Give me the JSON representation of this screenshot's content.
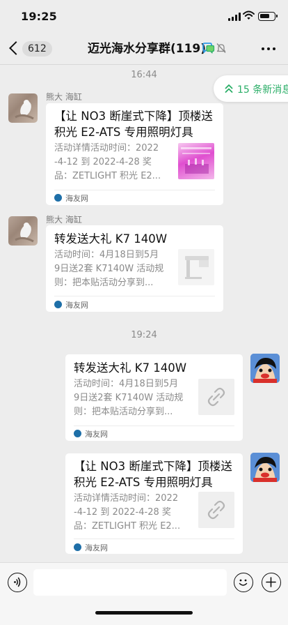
{
  "status_bar": {
    "time": "19:25"
  },
  "nav": {
    "back_count": "612",
    "title": "迈光海水分享群(119)"
  },
  "new_messages": {
    "label": "15 条新消息"
  },
  "timestamps": [
    "16:44",
    "19:24"
  ],
  "messages": [
    {
      "sender": "熊大 海缸",
      "title_lines": [
        "【让 NO3 断崖式下降】顶楼送",
        "积光 E2-ATS 专用照明灯具"
      ],
      "desc_lines": [
        "活动详情活动时间：2022",
        "-4-12 到 2022-4-28 奖",
        "品：ZETLIGHT 积光 E2..."
      ],
      "source": "海友网"
    },
    {
      "sender": "熊大 海缸",
      "title_lines": [
        "转发送大礼 K7 140W"
      ],
      "desc_lines": [
        "活动时间：4月18日到5月",
        "9日送2套 K7140W 活动规",
        "则：把本贴活动分享到..."
      ],
      "source": "海友网"
    },
    {
      "title_lines": [
        "转发送大礼 K7 140W"
      ],
      "desc_lines": [
        "活动时间：4月18日到5月",
        "9日送2套 K7140W 活动规",
        "则：把本贴活动分享到..."
      ],
      "source": "海友网"
    },
    {
      "title_lines": [
        "【让 NO3 断崖式下降】顶楼送",
        "积光 E2-ATS 专用照明灯具"
      ],
      "desc_lines": [
        "活动详情活动时间：2022",
        "-4-12 到 2022-4-28 奖",
        "品：ZETLIGHT 积光 E2..."
      ],
      "source": "海友网"
    }
  ],
  "icons": {
    "back": "chevron-left-icon",
    "group": "group-chat-icon",
    "mute": "mute-bell-icon",
    "more": "more-dots-icon",
    "new_messages": "chevrons-up-icon",
    "thumb_link": "link-icon",
    "source": "site-logo-icon",
    "voice": "voice-icon",
    "emoji": "emoji-icon",
    "plus": "plus-icon"
  },
  "colors": {
    "background": "#ededed",
    "bubble": "#ffffff",
    "accent_green": "#2aae67",
    "secondary_text": "#8a8a8a",
    "input_bar": "#f6f6f6"
  }
}
